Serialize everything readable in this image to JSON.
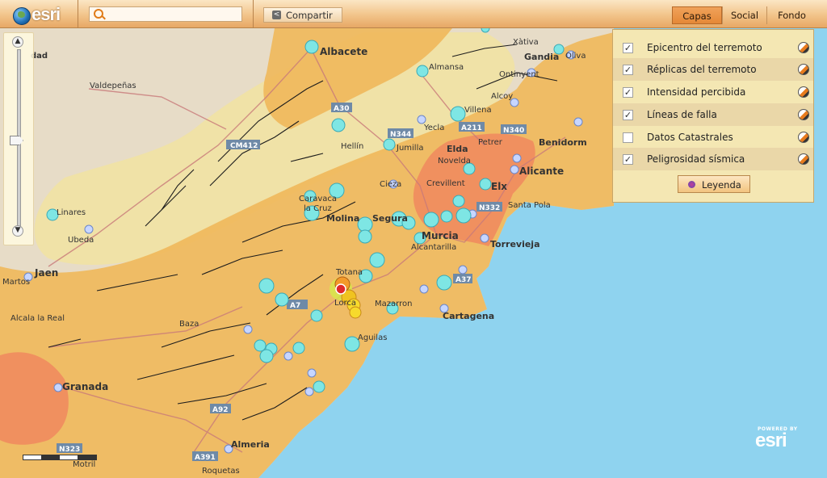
{
  "header": {
    "logo_text": "esri",
    "search": {
      "placeholder": "",
      "value": ""
    },
    "share_label": "Compartir",
    "tabs": [
      {
        "label": "Capas",
        "active": true
      },
      {
        "label": "Social",
        "active": false
      },
      {
        "label": "Fondo",
        "active": false
      }
    ]
  },
  "layers_panel": {
    "layers": [
      {
        "label": "Epicentro del terremoto",
        "checked": true
      },
      {
        "label": "Réplicas del terremoto",
        "checked": true
      },
      {
        "label": "Intensidad percibida",
        "checked": true
      },
      {
        "label": "Líneas de falla",
        "checked": true
      },
      {
        "label": "Datos Catastrales",
        "checked": false
      },
      {
        "label": "Peligrosidad sísmica",
        "checked": true
      }
    ],
    "legend_label": "Leyenda"
  },
  "map": {
    "place_labels": {
      "albacete": "Albacete",
      "valdepenas": "Valdepeñas",
      "almansa": "Almansa",
      "xativa": "Xàtiva",
      "gandia": "Gandia",
      "oliva": "Oliva",
      "ontinyent": "Ontinyent",
      "alcoy": "Alcoy",
      "villena": "Villena",
      "yecla": "Yecla",
      "jumilla": "Jumilla",
      "hellin": "Hellín",
      "petrer": "Petrer",
      "elda": "Elda",
      "benidorm": "Benidorm",
      "novelda": "Novelda",
      "alicante": "Alicante",
      "cieza": "Cieza",
      "crevillent": "Crevillent",
      "elx": "Elx",
      "santa_pola": "Santa Pola",
      "caravaca": "Caravaca",
      "la_cruz": "la Cruz",
      "molina": "Molina",
      "segura": "Segura",
      "murcia": "Murcia",
      "alcantarilla": "Alcantarilla",
      "torrevieja": "Torrevieja",
      "linares": "Linares",
      "ubeda": "Ubeda",
      "jaen": "Jaen",
      "martos": "Martos",
      "totana": "Totana",
      "lorca": "Lorca",
      "mazarron": "Mazarron",
      "cartagena": "Cartagena",
      "alcala_la_real": "Alcala la Real",
      "baza": "Baza",
      "aguilas": "Aguilas",
      "granada": "Granada",
      "almeria": "Almeria",
      "roquetas": "Roquetas",
      "motril": "Motril",
      "ciudad": "dad"
    },
    "road_shields": {
      "a30": "A30",
      "n344": "N344",
      "a211": "A211",
      "n340": "N340",
      "cm412": "CM412",
      "n332": "N332",
      "a37": "A37",
      "a7": "A7",
      "a92": "A92",
      "a391": "A391",
      "n323": "N323"
    },
    "colors": {
      "sea": "#8fd3ef",
      "land_base": "#e7dcc7",
      "hazard_low": "#f0e0a0",
      "hazard_medium": "#f0b456",
      "hazard_high": "#ef8757",
      "aftershock": "#7ee6e4",
      "small_quake": "#c7d6ff",
      "epicenter": "#e02a2a"
    }
  },
  "attribution": {
    "powered_by": "POWERED BY",
    "brand": "esri"
  }
}
